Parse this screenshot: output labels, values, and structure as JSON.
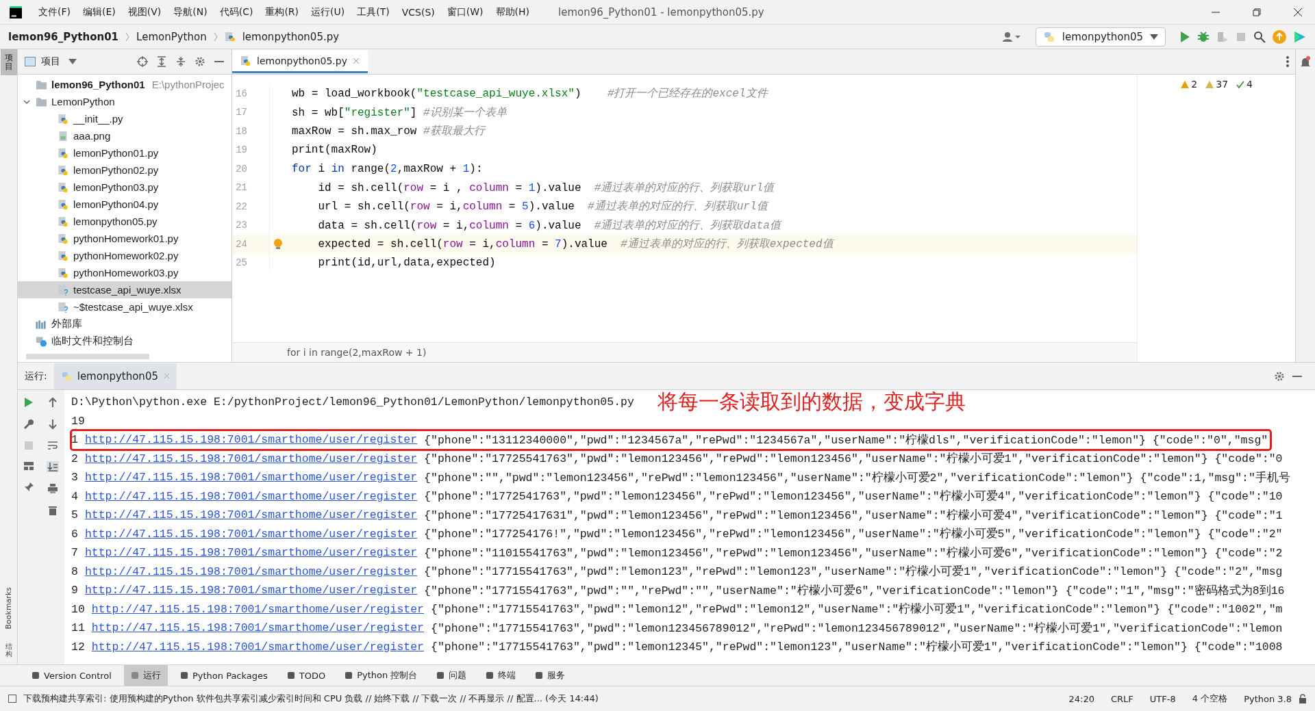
{
  "menu": [
    "文件(F)",
    "编辑(E)",
    "视图(V)",
    "导航(N)",
    "代码(C)",
    "重构(R)",
    "运行(U)",
    "工具(T)",
    "VCS(S)",
    "窗口(W)",
    "帮助(H)"
  ],
  "window": {
    "title": "lemon96_Python01 - lemonpython05.py"
  },
  "breadcrumb": [
    {
      "label": "lemon96_Python01",
      "kind": "project"
    },
    {
      "label": "LemonPython",
      "kind": "folder"
    },
    {
      "label": "lemonpython05.py",
      "kind": "file"
    }
  ],
  "run_config": "lemonpython05",
  "side_strip": {
    "top": "项目",
    "bottom": [
      {
        "label": "Bookmarks",
        "kind": "rotated"
      },
      {
        "label": "结构",
        "kind": "stacked"
      }
    ]
  },
  "project_panel": {
    "title": "项目",
    "tree": [
      {
        "label": "lemon96_Python01",
        "path": "E:\\pythonProjec",
        "kind": "root",
        "selected": false
      },
      {
        "label": "LemonPython",
        "kind": "folder",
        "expanded": true,
        "selected": false,
        "children": [
          {
            "label": "__init__.py",
            "kind": "py",
            "selected": false
          },
          {
            "label": "aaa.png",
            "kind": "image",
            "selected": false
          },
          {
            "label": "lemonPython01.py",
            "kind": "py",
            "selected": false
          },
          {
            "label": "lemonPython02.py",
            "kind": "py",
            "selected": false
          },
          {
            "label": "lemonPython03.py",
            "kind": "py",
            "selected": false
          },
          {
            "label": "lemonPython04.py",
            "kind": "py",
            "selected": false
          },
          {
            "label": "lemonpython05.py",
            "kind": "py",
            "selected": false
          },
          {
            "label": "pythonHomework01.py",
            "kind": "py",
            "selected": false
          },
          {
            "label": "pythonHomework02.py",
            "kind": "py",
            "selected": false
          },
          {
            "label": "pythonHomework03.py",
            "kind": "py",
            "selected": false
          },
          {
            "label": "testcase_api_wuye.xlsx",
            "kind": "unknown",
            "selected": true
          },
          {
            "label": "~$testcase_api_wuye.xlsx",
            "kind": "unknown",
            "selected": false
          }
        ]
      },
      {
        "label": "外部库",
        "kind": "library",
        "selected": false
      },
      {
        "label": "临时文件和控制台",
        "kind": "scratch",
        "selected": false
      }
    ]
  },
  "editor": {
    "tab": {
      "label": "lemonpython05.py",
      "selected": true
    },
    "inspections": [
      {
        "kind": "warning",
        "count": "2"
      },
      {
        "kind": "weak",
        "count": "37"
      },
      {
        "kind": "ok",
        "count": "4"
      }
    ],
    "lines": [
      {
        "number": "16",
        "current": false,
        "bulb": false,
        "segments": [
          {
            "kind": "plain",
            "text": "wb = load_workbook("
          },
          {
            "kind": "string",
            "text": "\"testcase_api_wuye.xlsx\""
          },
          {
            "kind": "plain",
            "text": ")    "
          },
          {
            "kind": "comment",
            "text": "#打开一个已经存在的excel文件"
          }
        ]
      },
      {
        "number": "17",
        "current": false,
        "bulb": false,
        "segments": [
          {
            "kind": "plain",
            "text": "sh = wb["
          },
          {
            "kind": "string",
            "text": "\"register\""
          },
          {
            "kind": "plain",
            "text": "] "
          },
          {
            "kind": "comment",
            "text": "#识别某一个表单"
          }
        ]
      },
      {
        "number": "18",
        "current": false,
        "bulb": false,
        "segments": [
          {
            "kind": "plain",
            "text": "maxRow = sh.max_row "
          },
          {
            "kind": "comment",
            "text": "#获取最大行"
          }
        ]
      },
      {
        "number": "19",
        "current": false,
        "bulb": false,
        "segments": [
          {
            "kind": "plain",
            "text": "print(maxRow)"
          }
        ]
      },
      {
        "number": "20",
        "current": false,
        "bulb": false,
        "segments": [
          {
            "kind": "keyword",
            "text": "for"
          },
          {
            "kind": "plain",
            "text": " i "
          },
          {
            "kind": "keyword",
            "text": "in"
          },
          {
            "kind": "plain",
            "text": " range("
          },
          {
            "kind": "number",
            "text": "2"
          },
          {
            "kind": "plain",
            "text": ",maxRow + "
          },
          {
            "kind": "number",
            "text": "1"
          },
          {
            "kind": "plain",
            "text": "):"
          }
        ]
      },
      {
        "number": "21",
        "current": false,
        "bulb": false,
        "segments": [
          {
            "kind": "plain",
            "text": "    id = sh.cell("
          },
          {
            "kind": "param",
            "text": "row"
          },
          {
            "kind": "plain",
            "text": " = i , "
          },
          {
            "kind": "param",
            "text": "column"
          },
          {
            "kind": "plain",
            "text": " = "
          },
          {
            "kind": "number",
            "text": "1"
          },
          {
            "kind": "plain",
            "text": ").value  "
          },
          {
            "kind": "comment",
            "text": "#通过表单的对应的行、列获取url值"
          }
        ]
      },
      {
        "number": "22",
        "current": false,
        "bulb": false,
        "segments": [
          {
            "kind": "plain",
            "text": "    url = sh.cell("
          },
          {
            "kind": "param",
            "text": "row"
          },
          {
            "kind": "plain",
            "text": " = i,"
          },
          {
            "kind": "param",
            "text": "column"
          },
          {
            "kind": "plain",
            "text": " = "
          },
          {
            "kind": "number",
            "text": "5"
          },
          {
            "kind": "plain",
            "text": ").value  "
          },
          {
            "kind": "comment",
            "text": "#通过表单的对应的行、列获取url值"
          }
        ]
      },
      {
        "number": "23",
        "current": false,
        "bulb": false,
        "segments": [
          {
            "kind": "plain",
            "text": "    data = sh.cell("
          },
          {
            "kind": "param",
            "text": "row"
          },
          {
            "kind": "plain",
            "text": " = i,"
          },
          {
            "kind": "param",
            "text": "column"
          },
          {
            "kind": "plain",
            "text": " = "
          },
          {
            "kind": "number",
            "text": "6"
          },
          {
            "kind": "plain",
            "text": ").value  "
          },
          {
            "kind": "comment",
            "text": "#通过表单的对应的行、列获取data值"
          }
        ]
      },
      {
        "number": "24",
        "current": true,
        "bulb": true,
        "segments": [
          {
            "kind": "plain",
            "text": "    expected = sh.cell("
          },
          {
            "kind": "param",
            "text": "row"
          },
          {
            "kind": "plain",
            "text": " = i,"
          },
          {
            "kind": "param",
            "text": "column"
          },
          {
            "kind": "plain",
            "text": " = "
          },
          {
            "kind": "number",
            "text": "7"
          },
          {
            "kind": "plain",
            "text": ").value  "
          },
          {
            "kind": "comment",
            "text": "#通过表单的对应的行、列获取expected值"
          }
        ]
      },
      {
        "number": "25",
        "current": false,
        "bulb": false,
        "segments": [
          {
            "kind": "plain",
            "text": "    print(id,url,data,expected)"
          }
        ]
      }
    ],
    "breadcrumb_hint": "for i in range(2,maxRow + 1)"
  },
  "run_panel": {
    "label": "运行:",
    "tab": "lemonpython05",
    "command": "D:\\Python\\python.exe E:/pythonProject/lemon96_Python01/LemonPython/lemonpython05.py",
    "output_first": "19",
    "annotation": "将每一条读取到的数据，变成字典",
    "rows": [
      {
        "index": "1",
        "url": "http://47.115.15.198:7001/smarthome/user/register",
        "data": "{\"phone\":\"13112340000\",\"pwd\":\"1234567a\",\"rePwd\":\"1234567a\",\"userName\":\"柠檬dls\",\"verificationCode\":\"lemon\"} {\"code\":\"0\",\"msg\"",
        "highlighted": true
      },
      {
        "index": "2",
        "url": "http://47.115.15.198:7001/smarthome/user/register",
        "data": "{\"phone\":\"17725541763\",\"pwd\":\"lemon123456\",\"rePwd\":\"lemon123456\",\"userName\":\"柠檬小可爱1\",\"verificationCode\":\"lemon\"} {\"code\":\"0",
        "highlighted": false
      },
      {
        "index": "3",
        "url": "http://47.115.15.198:7001/smarthome/user/register",
        "data": "{\"phone\":\"\",\"pwd\":\"lemon123456\",\"rePwd\":\"lemon123456\",\"userName\":\"柠檬小可爱2\",\"verificationCode\":\"lemon\"} {\"code\":1,\"msg\":\"手机号",
        "highlighted": false
      },
      {
        "index": "4",
        "url": "http://47.115.15.198:7001/smarthome/user/register",
        "data": "{\"phone\":\"1772541763\",\"pwd\":\"lemon123456\",\"rePwd\":\"lemon123456\",\"userName\":\"柠檬小可爱4\",\"verificationCode\":\"lemon\"} {\"code\":\"10",
        "highlighted": false
      },
      {
        "index": "5",
        "url": "http://47.115.15.198:7001/smarthome/user/register",
        "data": "{\"phone\":\"17725417631\",\"pwd\":\"lemon123456\",\"rePwd\":\"lemon123456\",\"userName\":\"柠檬小可爱4\",\"verificationCode\":\"lemon\"} {\"code\":\"1",
        "highlighted": false
      },
      {
        "index": "6",
        "url": "http://47.115.15.198:7001/smarthome/user/register",
        "data": "{\"phone\":\"177254176!\",\"pwd\":\"lemon123456\",\"rePwd\":\"lemon123456\",\"userName\":\"柠檬小可爱5\",\"verificationCode\":\"lemon\"} {\"code\":\"2\"",
        "highlighted": false
      },
      {
        "index": "7",
        "url": "http://47.115.15.198:7001/smarthome/user/register",
        "data": "{\"phone\":\"11015541763\",\"pwd\":\"lemon123456\",\"rePwd\":\"lemon123456\",\"userName\":\"柠檬小可爱6\",\"verificationCode\":\"lemon\"} {\"code\":\"2",
        "highlighted": false
      },
      {
        "index": "8",
        "url": "http://47.115.15.198:7001/smarthome/user/register",
        "data": "{\"phone\":\"17715541763\",\"pwd\":\"lemon123\",\"rePwd\":\"lemon123\",\"userName\":\"柠檬小可爱1\",\"verificationCode\":\"lemon\"} {\"code\":\"2\",\"msg",
        "highlighted": false
      },
      {
        "index": "9",
        "url": "http://47.115.15.198:7001/smarthome/user/register",
        "data": "{\"phone\":\"17715541763\",\"pwd\":\"\",\"rePwd\":\"\",\"userName\":\"柠檬小可爱6\",\"verificationCode\":\"lemon\"} {\"code\":\"1\",\"msg\":\"密码格式为8到16",
        "highlighted": false
      },
      {
        "index": "10",
        "url": "http://47.115.15.198:7001/smarthome/user/register",
        "data": "{\"phone\":\"17715541763\",\"pwd\":\"lemon12\",\"rePwd\":\"lemon12\",\"userName\":\"柠檬小可爱1\",\"verificationCode\":\"lemon\"} {\"code\":\"1002\",\"m",
        "highlighted": false
      },
      {
        "index": "11",
        "url": "http://47.115.15.198:7001/smarthome/user/register",
        "data": "{\"phone\":\"17715541763\",\"pwd\":\"lemon123456789012\",\"rePwd\":\"lemon123456789012\",\"userName\":\"柠檬小可爱1\",\"verificationCode\":\"lemon",
        "highlighted": false
      },
      {
        "index": "12",
        "url": "http://47.115.15.198:7001/smarthome/user/register",
        "data": "{\"phone\":\"17715541763\",\"pwd\":\"lemon12345\",\"rePwd\":\"lemon123\",\"userName\":\"柠檬小可爱1\",\"verificationCode\":\"lemon\"} {\"code\":\"1008",
        "highlighted": false
      }
    ]
  },
  "tool_tabs": [
    {
      "label": "Version Control",
      "selected": false
    },
    {
      "label": "运行",
      "selected": true
    },
    {
      "label": "Python Packages",
      "selected": false
    },
    {
      "label": "TODO",
      "selected": false
    },
    {
      "label": "Python 控制台",
      "selected": false
    },
    {
      "label": "问题",
      "selected": false
    },
    {
      "label": "终端",
      "selected": false
    },
    {
      "label": "服务",
      "selected": false
    }
  ],
  "status_bar": {
    "message": "下载预构建共享索引: 使用预构建的Python 软件包共享索引减少索引时间和 CPU 负载 // 始终下载 // 下载一次 // 不再显示 // 配置... (今天 14:44)",
    "items": [
      "24:20",
      "CRLF",
      "UTF-8",
      "4 个空格",
      "Python 3.8"
    ]
  }
}
